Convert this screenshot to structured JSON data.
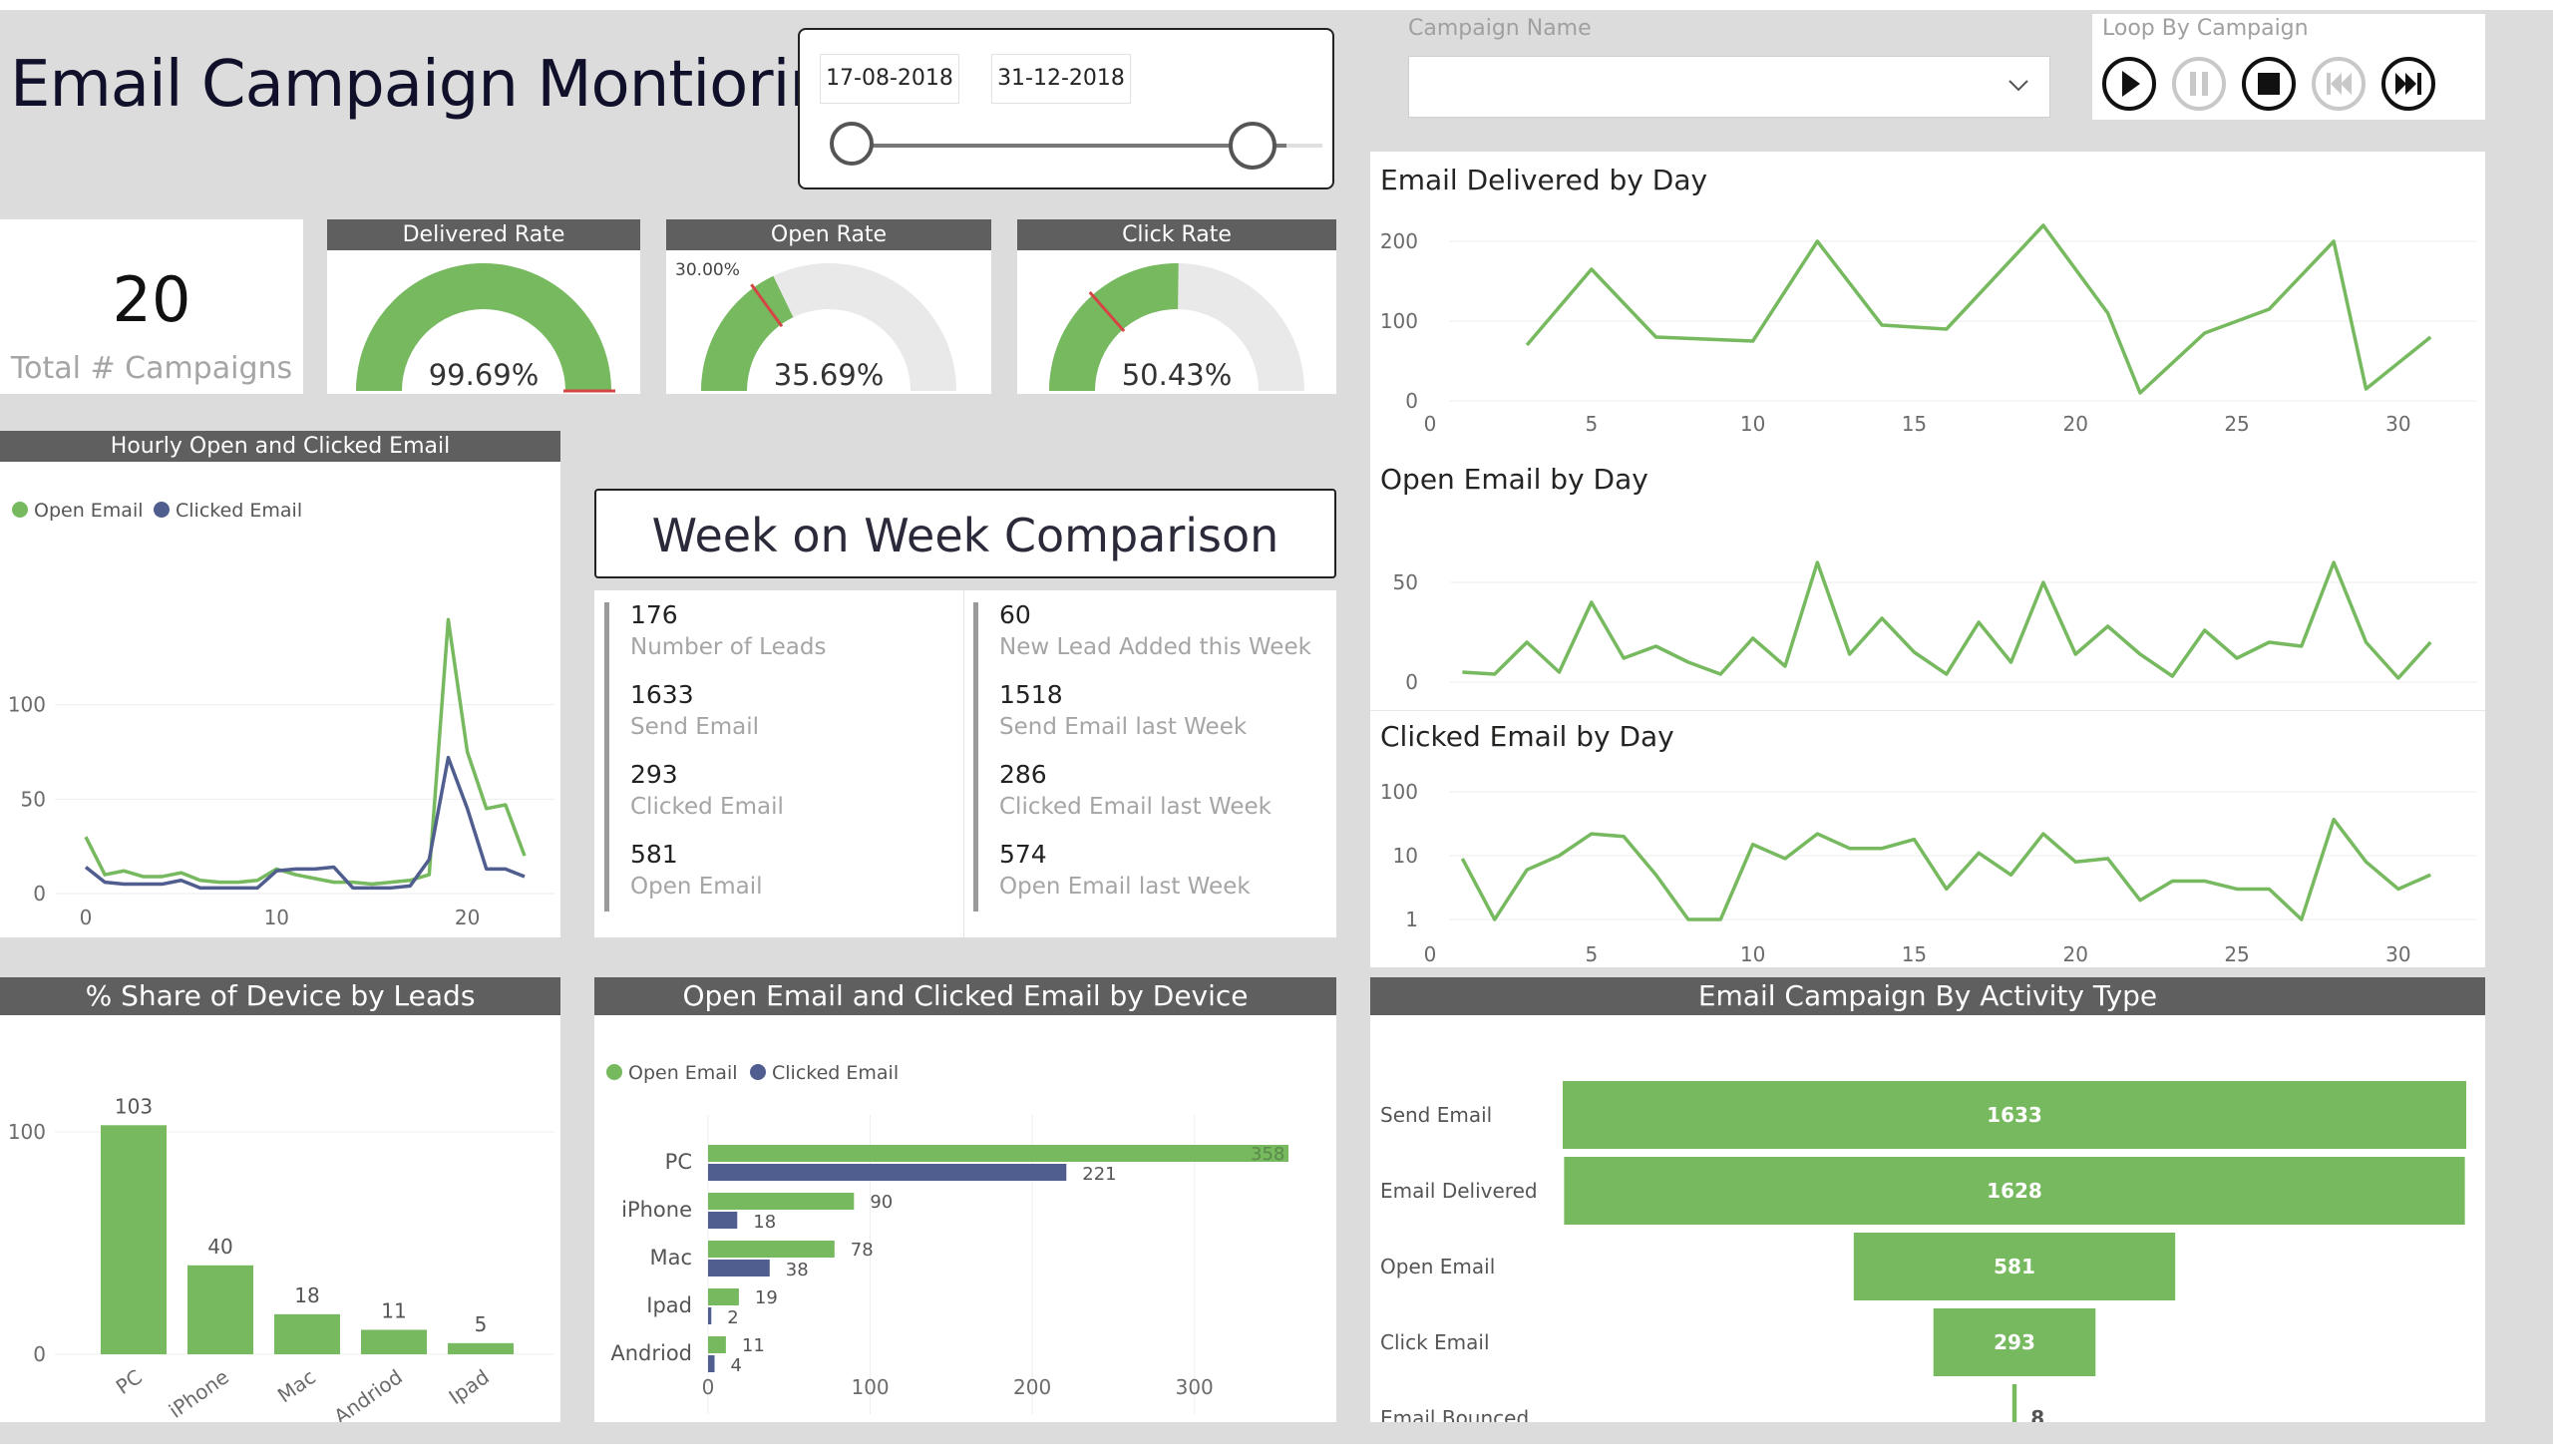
{
  "header": {
    "title": "Email Campaign Montioring",
    "date_start": "17-08-2018",
    "date_end": "31-12-2018",
    "campaign_filter_label": "Campaign Name",
    "loop_label": "Loop By Campaign"
  },
  "kpi": {
    "total_value": "20",
    "total_label": "Total # Campaigns"
  },
  "gauges": [
    {
      "title": "Delivered Rate",
      "value_label": "99.69%",
      "fill": 0.9969,
      "target": 1.0,
      "target_label": ""
    },
    {
      "title": "Open Rate",
      "value_label": "35.69%",
      "fill": 0.3569,
      "target": 0.3,
      "target_label": "30.00%"
    },
    {
      "title": "Click Rate",
      "value_label": "50.43%",
      "fill": 0.5043,
      "target": 0.27,
      "target_label": ""
    }
  ],
  "hourly": {
    "title": "Hourly Open and Clicked Email",
    "legend": [
      "Open Email",
      "Clicked Email"
    ],
    "colors": [
      "#76b95f",
      "#4f5d8f"
    ],
    "chart_data": {
      "type": "line",
      "x": [
        0,
        1,
        2,
        3,
        4,
        5,
        6,
        7,
        8,
        9,
        10,
        11,
        12,
        13,
        14,
        15,
        16,
        17,
        18,
        19,
        20,
        21,
        22,
        23
      ],
      "series": [
        {
          "name": "Open Email",
          "values": [
            30,
            10,
            12,
            9,
            9,
            11,
            7,
            6,
            6,
            7,
            13,
            10,
            8,
            6,
            6,
            5,
            6,
            7,
            10,
            145,
            75,
            45,
            47,
            20
          ]
        },
        {
          "name": "Clicked Email",
          "values": [
            14,
            6,
            5,
            5,
            5,
            7,
            3,
            3,
            3,
            3,
            12,
            13,
            13,
            14,
            3,
            3,
            3,
            4,
            18,
            72,
            45,
            13,
            13,
            9
          ]
        }
      ],
      "y_ticks": [
        "0",
        "50",
        "100"
      ],
      "x_ticks": [
        "0",
        "10",
        "20"
      ],
      "ylim": [
        0,
        160
      ]
    }
  },
  "week": {
    "title": "Week on Week Comparison",
    "left": [
      {
        "value": "176",
        "label": "Number of Leads"
      },
      {
        "value": "1633",
        "label": "Send Email"
      },
      {
        "value": "293",
        "label": "Clicked Email"
      },
      {
        "value": "581",
        "label": "Open Email"
      }
    ],
    "right": [
      {
        "value": "60",
        "label": "New Lead Added this Week"
      },
      {
        "value": "1518",
        "label": "Send Email last Week"
      },
      {
        "value": "286",
        "label": "Clicked Email last Week"
      },
      {
        "value": "574",
        "label": "Open Email last Week"
      }
    ]
  },
  "delivered_day": {
    "title": "Email Delivered by Day",
    "chart_data": {
      "type": "line",
      "x": [
        3,
        5,
        7,
        10,
        12,
        14,
        16,
        19,
        21,
        22,
        24,
        26,
        28,
        29,
        31
      ],
      "values": [
        70,
        165,
        80,
        75,
        200,
        95,
        90,
        220,
        110,
        10,
        85,
        115,
        200,
        15,
        80
      ],
      "y_ticks": [
        "0",
        "100",
        "200"
      ],
      "x_ticks": [
        "0",
        "5",
        "10",
        "15",
        "20",
        "25",
        "30"
      ],
      "xlim": [
        0,
        31
      ],
      "ylim": [
        0,
        230
      ]
    }
  },
  "open_day": {
    "title": "Open Email by Day",
    "chart_data": {
      "type": "line",
      "x": [
        1,
        2,
        3,
        4,
        5,
        6,
        7,
        8,
        9,
        10,
        11,
        12,
        13,
        14,
        15,
        16,
        17,
        18,
        19,
        20,
        21,
        22,
        23,
        24,
        25,
        26,
        27,
        28,
        29,
        30,
        31
      ],
      "values": [
        5,
        4,
        20,
        5,
        40,
        12,
        18,
        10,
        4,
        22,
        8,
        60,
        14,
        32,
        15,
        4,
        30,
        10,
        50,
        14,
        28,
        14,
        3,
        26,
        12,
        20,
        18,
        60,
        20,
        2,
        20
      ],
      "y_ticks": [
        "0",
        "50"
      ],
      "xlim": [
        0,
        31
      ],
      "ylim": [
        0,
        65
      ]
    }
  },
  "clicked_day": {
    "title": "Clicked Email by Day",
    "chart_data": {
      "type": "line",
      "scale": "log",
      "x": [
        1,
        2,
        3,
        4,
        5,
        6,
        7,
        8,
        9,
        10,
        11,
        12,
        13,
        14,
        15,
        16,
        17,
        18,
        19,
        20,
        21,
        22,
        23,
        24,
        25,
        26,
        27,
        28,
        29,
        30,
        31
      ],
      "values": [
        9,
        1,
        6,
        10,
        22,
        20,
        5,
        1,
        1,
        15,
        9,
        22,
        13,
        13,
        18,
        3,
        11,
        5,
        22,
        8,
        9,
        2,
        4,
        4,
        3,
        3,
        1,
        37,
        8,
        3,
        5
      ],
      "y_ticks": [
        "1",
        "10",
        "100"
      ],
      "x_ticks": [
        "0",
        "5",
        "10",
        "15",
        "20",
        "25",
        "30"
      ],
      "xlim": [
        0,
        31
      ],
      "ylim": [
        1,
        100
      ]
    }
  },
  "device_share": {
    "title": "% Share of Device by Leads",
    "chart_data": {
      "type": "bar",
      "categories": [
        "PC",
        "iPhone",
        "Mac",
        "Andriod",
        "Ipad"
      ],
      "values": [
        103,
        40,
        18,
        11,
        5
      ],
      "y_ticks": [
        "0",
        "100"
      ],
      "ylim": [
        0,
        115
      ]
    }
  },
  "device_email": {
    "title": "Open Email and Clicked Email by Device",
    "legend": [
      "Open Email",
      "Clicked Email"
    ],
    "chart_data": {
      "type": "bar",
      "orientation": "horizontal",
      "categories": [
        "PC",
        "iPhone",
        "Mac",
        "Ipad",
        "Andriod"
      ],
      "series": [
        {
          "name": "Open Email",
          "values": [
            358,
            90,
            78,
            19,
            11
          ]
        },
        {
          "name": "Clicked Email",
          "values": [
            221,
            18,
            38,
            2,
            4
          ]
        }
      ],
      "x_ticks": [
        "0",
        "100",
        "200",
        "300"
      ],
      "xlim": [
        0,
        358
      ]
    }
  },
  "activity": {
    "title": "Email Campaign By Activity Type",
    "chart_data": {
      "type": "bar",
      "style": "funnel",
      "categories": [
        "Send Email",
        "Email Delivered",
        "Open Email",
        "Click Email",
        "Email Bounced"
      ],
      "values": [
        1633,
        1628,
        581,
        293,
        8
      ],
      "value_labels": [
        "1633",
        "1628",
        "581",
        "293",
        "8"
      ]
    }
  }
}
